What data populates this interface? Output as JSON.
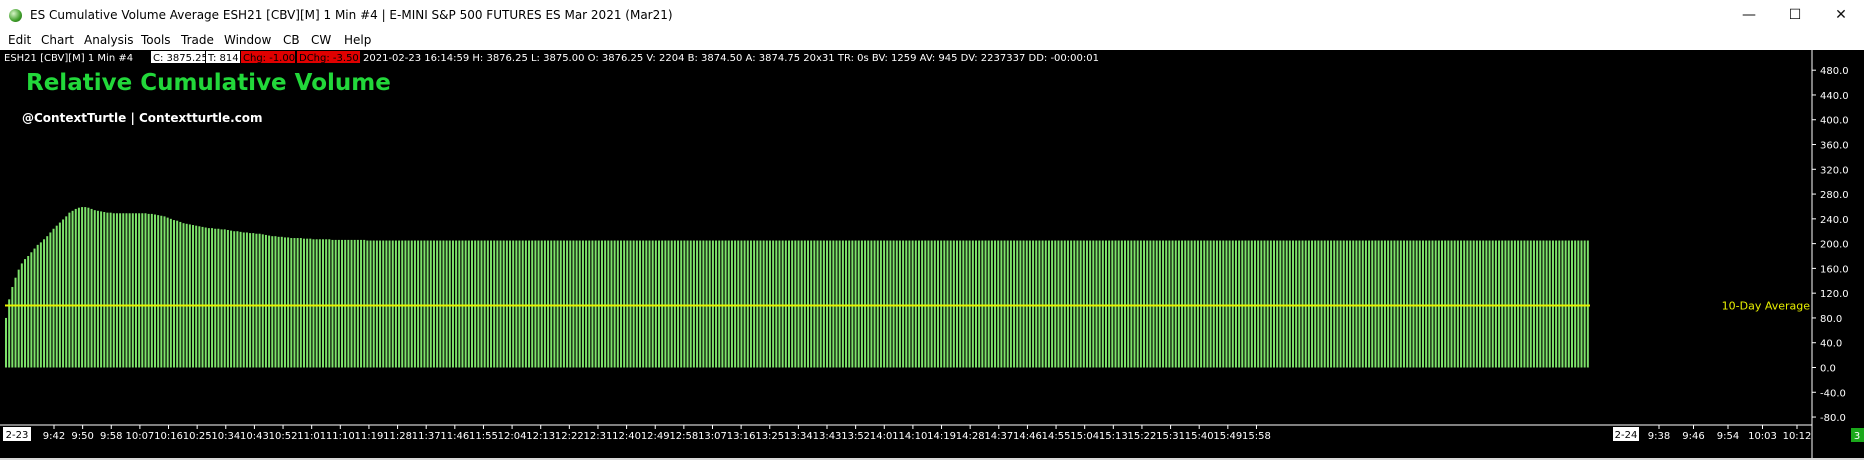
{
  "window": {
    "title": "ES Cumulative Volume Average ESH21 [CBV][M]  1 Min   #4 | E-MINI S&P 500 FUTURES ES Mar 2021 (Mar21)",
    "minimize": "—",
    "maximize": "☐",
    "close": "✕"
  },
  "menu": [
    "Edit",
    "Chart",
    "Analysis",
    "Tools",
    "Trade",
    "Window",
    "CB",
    "CW",
    "Help"
  ],
  "infobar": {
    "symbol": "ESH21 [CBV][M]  1 Min   #4",
    "last": "C: 3875.25",
    "ticks": "T: 814",
    "chg": "Chg: -1.00",
    "dchg": "DChg: -3.50",
    "details": "2021-02-23 16:14:59 H: 3876.25 L: 3875.00 O: 3876.25 V: 2204 B: 3874.50 A: 3874.75 20x31 TR: 0s BV: 1259 AV: 945 DV: 2237337 DD: -00:00:01"
  },
  "overlay": {
    "title": "Relative Cumulative Volume",
    "credit": "@ContextTurtle | Contextturtle.com"
  },
  "colors": {
    "background": "#000000",
    "bars": "#7de26a",
    "average_line": "#e8f000",
    "title_text": "#22d83a",
    "chg_bg": "#e00000",
    "axis_text": "#ffffff"
  },
  "chart_data": {
    "type": "bar",
    "ylim": [
      -88,
      490
    ],
    "y_ticks": [
      "480.0",
      "440.0",
      "400.0",
      "360.0",
      "320.0",
      "280.0",
      "240.0",
      "200.0",
      "160.0",
      "120.0",
      "80.0",
      "40.0",
      "0.0",
      "-40.0",
      "-80.0"
    ],
    "y_tick_values": [
      480,
      440,
      400,
      360,
      320,
      280,
      240,
      200,
      160,
      120,
      80,
      40,
      0,
      -40,
      -80
    ],
    "x_start_label": "2-23",
    "x_ticks": [
      "9:42",
      "9:50",
      "9:58",
      "10:07",
      "10:16",
      "10:25",
      "10:34",
      "10:43",
      "10:52",
      "11:01",
      "11:10",
      "11:19",
      "11:28",
      "11:37",
      "11:46",
      "11:55",
      "12:04",
      "12:13",
      "12:22",
      "12:31",
      "12:40",
      "12:49",
      "12:58",
      "13:07",
      "13:16",
      "13:25",
      "13:34",
      "13:43",
      "13:52",
      "14:01",
      "14:10",
      "14:19",
      "14:28",
      "14:37",
      "14:46",
      "14:55",
      "15:04",
      "15:13",
      "15:22",
      "15:31",
      "15:40",
      "15:49",
      "15:58"
    ],
    "x_day_label": "2-24",
    "x_ticks_future": [
      "9:38",
      "9:46",
      "9:54",
      "10:03",
      "10:12"
    ],
    "corner_label": "3",
    "average": {
      "label": "10-Day Average",
      "value": 100
    },
    "series": [
      {
        "start_time": "9:30",
        "interval_minutes": 1,
        "values": [
          80,
          110,
          130,
          145,
          158,
          168,
          175,
          180,
          186,
          192,
          198,
          202,
          207,
          212,
          218,
          224,
          229,
          234,
          239,
          244,
          250,
          253,
          256,
          258,
          259,
          259,
          258,
          256,
          254,
          253,
          252,
          251,
          250,
          250,
          249,
          249,
          249,
          249,
          249,
          249,
          249,
          249,
          249,
          249,
          249,
          248,
          248,
          247,
          246,
          245,
          244,
          242,
          240,
          238,
          237,
          235,
          233,
          232,
          231,
          230,
          229,
          228,
          227,
          226,
          225,
          225,
          224,
          224,
          223,
          223,
          222,
          221,
          220,
          220,
          219,
          218,
          218,
          217,
          217,
          216,
          216,
          215,
          214,
          213,
          212,
          212,
          211,
          211,
          210,
          210,
          209,
          209,
          209,
          209,
          208,
          208,
          208,
          207,
          207,
          207,
          207,
          207,
          207,
          206,
          206,
          206,
          206,
          206,
          206,
          206,
          206,
          206,
          206,
          206,
          205,
          205,
          205,
          205,
          205,
          205,
          205,
          205,
          205,
          205,
          205,
          205,
          205,
          205,
          205,
          205,
          205,
          205,
          205,
          205,
          205,
          205,
          205,
          205,
          205,
          205,
          205,
          205,
          205,
          205,
          205,
          205,
          205,
          205,
          205,
          205,
          205,
          205,
          205,
          205,
          205,
          205,
          205,
          205,
          205,
          205,
          205,
          205,
          205,
          205,
          205,
          205,
          205,
          205,
          205,
          205,
          205,
          205,
          205,
          205,
          205,
          205,
          205,
          205,
          205,
          205,
          205,
          205,
          205,
          205,
          205,
          205,
          205,
          205,
          205,
          205,
          205,
          205,
          205,
          205,
          205,
          205,
          205,
          205,
          205,
          205,
          205,
          205,
          205,
          205,
          205,
          205,
          205,
          205,
          205,
          205,
          205,
          205,
          205,
          205,
          205,
          205,
          205,
          205,
          205,
          205,
          205,
          205,
          205,
          205,
          205,
          205,
          205,
          205,
          205,
          205,
          205,
          205,
          205,
          205,
          205,
          205,
          205,
          205,
          205,
          205,
          205,
          205,
          205,
          205,
          205,
          205,
          205,
          205,
          205,
          205,
          205,
          205,
          205,
          205,
          205,
          205,
          205,
          205,
          205,
          205,
          205,
          205,
          205,
          205,
          205,
          205,
          205,
          205,
          205,
          205,
          205,
          205,
          205,
          205,
          205,
          205,
          205,
          205,
          205,
          205,
          205,
          205,
          205,
          205,
          205,
          205,
          205,
          205,
          205,
          205,
          205,
          205,
          205,
          205,
          205,
          205,
          205,
          205,
          205,
          205,
          205,
          205,
          205,
          205,
          205,
          205,
          205,
          205,
          205,
          205,
          205,
          205,
          205,
          205,
          205,
          205,
          205,
          205,
          205,
          205,
          205,
          205,
          205,
          205,
          205,
          205,
          205,
          205,
          205,
          205,
          205,
          205,
          205,
          205,
          205,
          205,
          205,
          205,
          205,
          205,
          205,
          205,
          205,
          205,
          205,
          205,
          205,
          205,
          205,
          205,
          205,
          205,
          205,
          205,
          205,
          205,
          205,
          205,
          205,
          205,
          205,
          205,
          205,
          205,
          205,
          205,
          205,
          205,
          205,
          205,
          205,
          205,
          205,
          205,
          205,
          205,
          205,
          205,
          205,
          205,
          205,
          205,
          205,
          205,
          205,
          205,
          205,
          205,
          205,
          205,
          205,
          205,
          205,
          205,
          205,
          205,
          205,
          205,
          205,
          205,
          205,
          205,
          205,
          205,
          205,
          205,
          205,
          205,
          205,
          205,
          205,
          205,
          205,
          205,
          205,
          205,
          205,
          205,
          205,
          205,
          205,
          205,
          205,
          205,
          205,
          205,
          205,
          205,
          205,
          205,
          205,
          205,
          205,
          205,
          205,
          205,
          205,
          205,
          205,
          205,
          205,
          205,
          205,
          205,
          205,
          205,
          205,
          205,
          205,
          205,
          205,
          205,
          205,
          205,
          205,
          205,
          205,
          205,
          205,
          205,
          205,
          205,
          205,
          205,
          205,
          205,
          205,
          205,
          205,
          205,
          205,
          205,
          205,
          205,
          205,
          205,
          205,
          205,
          205,
          205,
          205,
          205,
          205,
          205,
          205,
          205,
          205,
          205,
          205,
          205,
          205,
          205,
          205,
          205,
          205,
          205,
          205,
          205,
          205,
          205
        ]
      }
    ]
  }
}
